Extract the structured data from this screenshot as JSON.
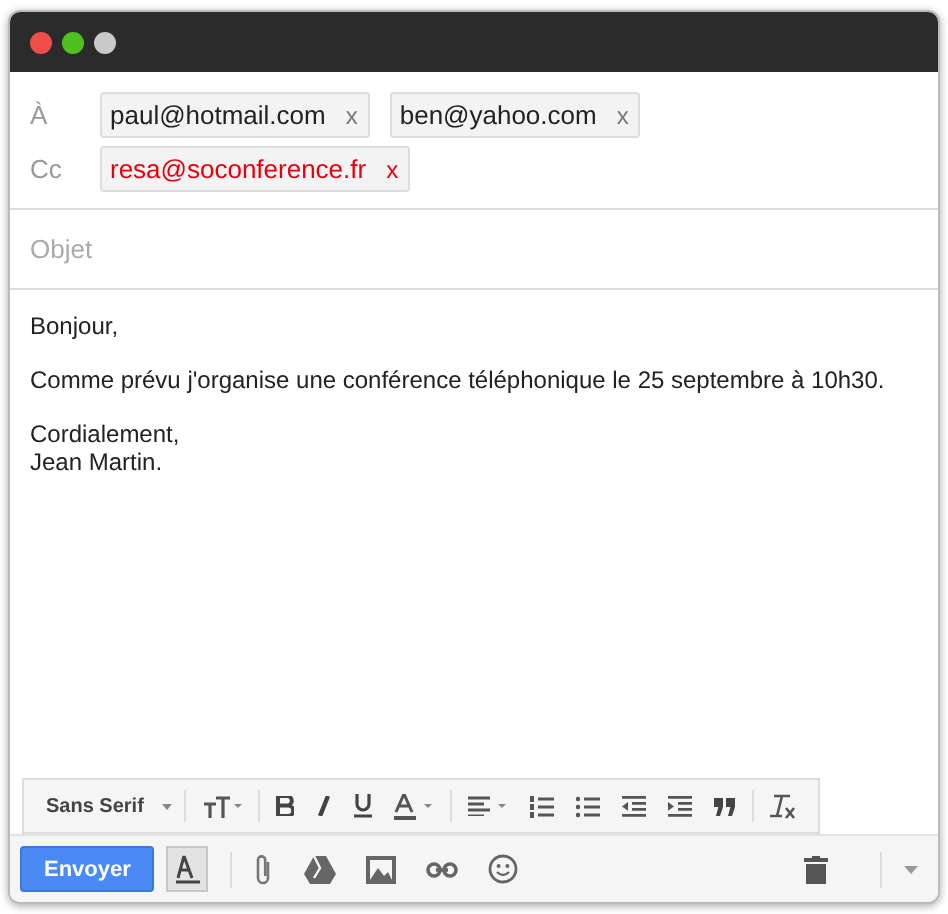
{
  "recipients": [
    {
      "label": "À",
      "chips": [
        {
          "address": "paul@hotmail.com",
          "remove": "x",
          "invalid": false
        },
        {
          "address": "ben@yahoo.com",
          "remove": "x",
          "invalid": false
        }
      ]
    },
    {
      "label": "Cc",
      "chips": [
        {
          "address": "resa@soconference.fr",
          "remove": "x",
          "invalid": true
        }
      ]
    }
  ],
  "subject": {
    "placeholder": "Objet"
  },
  "body": {
    "paragraphs": [
      [
        "Bonjour,"
      ],
      [
        "Comme prévu j'organise une conférence téléphonique le 25 septembre à 10h30."
      ],
      [
        "Cordialement,",
        "Jean Martin."
      ]
    ]
  },
  "format_toolbar": {
    "font": "Sans Serif"
  },
  "send_button": "Envoyer",
  "formatting_toggle": {
    "selected": true
  }
}
